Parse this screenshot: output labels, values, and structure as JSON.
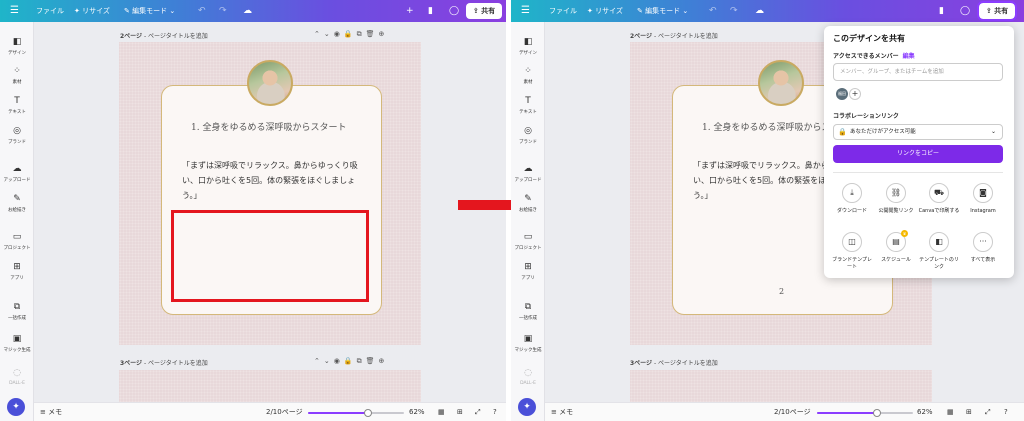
{
  "topbar": {
    "menu_icon": "hamburger-icon",
    "file": "ファイル",
    "resize": "リサイズ",
    "edit_mode": "編集モード",
    "share": "共有"
  },
  "sidebar": {
    "items": [
      {
        "label": "デザイン",
        "icon": "layout-icon"
      },
      {
        "label": "素材",
        "icon": "shapes-icon"
      },
      {
        "label": "テキスト",
        "icon": "text-icon"
      },
      {
        "label": "ブランド",
        "icon": "brand-icon"
      },
      {
        "label": "アップロード",
        "icon": "upload-icon"
      },
      {
        "label": "お絵描き",
        "icon": "draw-icon"
      },
      {
        "label": "プロジェクト",
        "icon": "folder-icon"
      },
      {
        "label": "アプリ",
        "icon": "apps-icon"
      },
      {
        "label": "一括作成",
        "icon": "bulk-icon"
      },
      {
        "label": "マジック生成",
        "icon": "magic-media-icon"
      },
      {
        "label": "DALL-E",
        "icon": "dalle-icon"
      }
    ]
  },
  "pages": {
    "page2_label": "2ページ",
    "page2_title": "ページタイトルを追加",
    "page3_label": "3ページ",
    "page3_title": "ページタイトルを追加"
  },
  "card": {
    "heading": "1. 全身をゆるめる深呼吸からスタート",
    "body": "「まずは深呼吸でリラックス。鼻からゆっくり吸い、口から吐くを5回。体の緊張をほぐしましょう。」",
    "page_number": "2"
  },
  "bottombar": {
    "notes": "メモ",
    "page_indicator": "2/10ページ",
    "zoom": "62%",
    "zoom_level": 0.62
  },
  "share_panel": {
    "title": "このデザインを共有",
    "access_label": "アクセスできるメンバー",
    "edit_link": "編集",
    "search_placeholder": "メンバー、グループ、またはチームを追加",
    "member_initials": "福田",
    "collab_link_label": "コラボレーションリンク",
    "access_option": "あなただけがアクセス可能",
    "copy_link": "リンクをコピー",
    "options": [
      {
        "label": "ダウンロード",
        "icon": "download-icon"
      },
      {
        "label": "公開閲覧リンク",
        "icon": "link-icon"
      },
      {
        "label": "Canvaで印刷する",
        "icon": "truck-icon"
      },
      {
        "label": "Instagram",
        "icon": "instagram-icon"
      },
      {
        "label": "ブランドテンプレート",
        "icon": "brand-template-icon"
      },
      {
        "label": "スケジュール",
        "icon": "calendar-icon"
      },
      {
        "label": "テンプレートのリンク",
        "icon": "template-link-icon"
      },
      {
        "label": "すべて表示",
        "icon": "more-icon"
      }
    ]
  },
  "colors": {
    "accent": "#8b3dff",
    "highlight": "#e4161e",
    "arrow": "#e4161e"
  }
}
